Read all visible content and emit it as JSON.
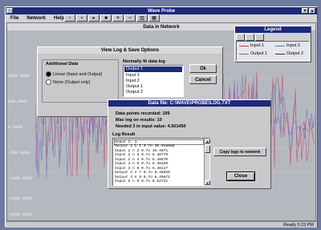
{
  "app": {
    "title": "Wave Probe",
    "menu": [
      "File",
      "Network",
      "Help"
    ]
  },
  "plot_panel": {
    "title": "Data in Network",
    "y_ticks": [
      "1000.0000",
      "500.0000",
      "0.0000",
      "-500.0000",
      "-1000.0000",
      "-1500.0000",
      "-2000.0000"
    ]
  },
  "legend": {
    "title": "Legend",
    "items": [
      "Input 1",
      "Input 2",
      "Output 1",
      "Output 2"
    ]
  },
  "view_dialog": {
    "title": "View Log & Save Options",
    "group_label": "Additional Data",
    "radio_1": "Linear (Input and Output)",
    "radio_2": "None (Output only)",
    "list_label": "Normally fit data log",
    "list_items": [
      "Output 1",
      "Input 1",
      "Input 2",
      "Output 1",
      "Output 2"
    ],
    "ok_label": "Ok",
    "cancel_label": "Cancel"
  },
  "log_dialog": {
    "title": "Data file: C:\\WAVE\\PROBE\\LOG.TXT",
    "line_1": "Data points recorded: 199",
    "line_2": "Max log on results: 10",
    "line_3": "Needed 3 in input value: 4.501450",
    "log_label": "Log Result",
    "log_rows": [
      "Input 1:  1",
      "Output 2  n 1  0.7o  35.948888",
      "Input 2  n 2  0.7o  35.4871",
      "Input 2  n 3  0.7o  6.48770",
      "Input 2  n 4  0.7o  6.48570",
      "Input 3  n 5  0.7o  6.48120",
      "Input 3  n 6  0.7o  5.48117",
      "Output 2  n 7  0.7o  6.48020",
      "Output 4  n 8  0.7o  6.49871",
      "Input 6  n 9  0.7o  8.52721"
    ],
    "copy_label": "Copy logs to network",
    "close_label": "Close"
  },
  "status": {
    "left": "",
    "right": "Ready  5:23 PM"
  },
  "colors": {
    "desktop": "#6f7aa2",
    "titlebar": "#1b2a7c",
    "plot_bg": "#b6b8bf",
    "dialog_face": "#c9c9cc",
    "trace_red": "#c23a58",
    "trace_blue": "#5a6fb0",
    "trace_purple": "#9a5ac0"
  }
}
